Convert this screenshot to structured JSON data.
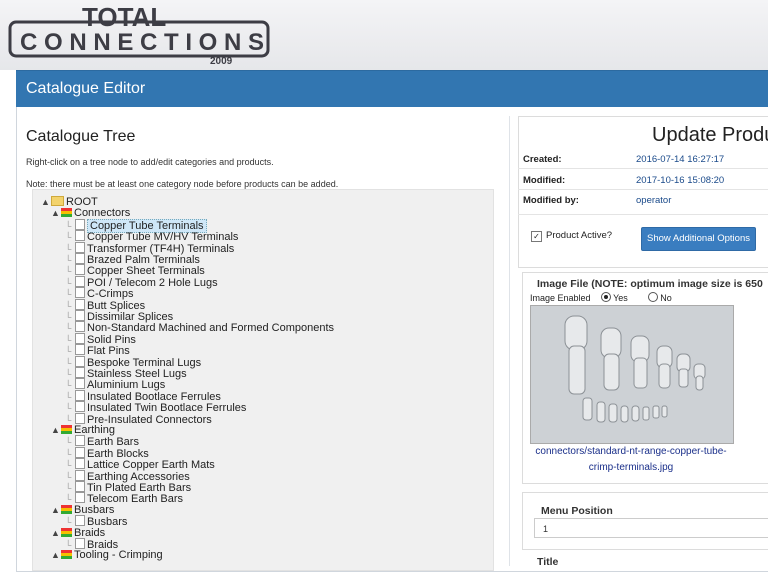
{
  "header": {
    "logo_line1": "TOTAL",
    "logo_line2": "CONNECTIONS",
    "logo_year": "2009"
  },
  "titlebar": {
    "title": "Catalogue Editor"
  },
  "tree_panel": {
    "title": "Catalogue Tree",
    "help1": "Right-click on a tree node to add/edit categories and products.",
    "help2": "Note: there must be at least one category node before products can be added."
  },
  "tree": {
    "root": "ROOT",
    "categories": [
      {
        "name": "Connectors",
        "items": [
          "Copper Tube Terminals",
          "Copper Tube MV/HV Terminals",
          "Transformer (TF4H) Terminals",
          "Brazed Palm Terminals",
          "Copper Sheet Terminals",
          "POI / Telecom 2 Hole Lugs",
          "C-Crimps",
          "Butt Splices",
          "Dissimilar Splices",
          "Non-Standard Machined and Formed Components",
          "Solid Pins",
          "Flat Pins",
          "Bespoke Terminal Lugs",
          "Stainless Steel Lugs",
          "Aluminium Lugs",
          "Insulated Bootlace Ferrules",
          "Insulated Twin Bootlace Ferrules",
          "Pre-Insulated Connectors"
        ]
      },
      {
        "name": "Earthing",
        "items": [
          "Earth Bars",
          "Earth Blocks",
          "Lattice Copper Earth Mats",
          "Earthing Accessories",
          "Tin Plated Earth Bars",
          "Telecom Earth Bars"
        ]
      },
      {
        "name": "Busbars",
        "items": [
          "Busbars"
        ]
      },
      {
        "name": "Braids",
        "items": [
          "Braids"
        ]
      },
      {
        "name": "Tooling - Crimping",
        "items": []
      }
    ],
    "selected": "Copper Tube Terminals"
  },
  "product": {
    "title": "Update Product",
    "created_label": "Created:",
    "created_value": "2016-07-14 16:27:17",
    "modified_label": "Modified:",
    "modified_value": "2017-10-16 15:08:20",
    "modified_by_label": "Modified by:",
    "modified_by_value": "operator",
    "active_label": "Product Active?",
    "active_checked": true,
    "options_button": "Show Additional Options"
  },
  "image_panel": {
    "heading": "Image File (NOTE: optimum image size is 650",
    "enabled_label": "Image Enabled",
    "yes": "Yes",
    "no": "No",
    "caption": "connectors/standard-nt-range-copper-tube-crimp-terminals.jpg"
  },
  "menu_position": {
    "label": "Menu Position",
    "value": "1"
  },
  "next_section": {
    "label": "Title"
  },
  "colors": {
    "brand_blue": "#3276b1",
    "link_blue": "#1a4a8a"
  }
}
